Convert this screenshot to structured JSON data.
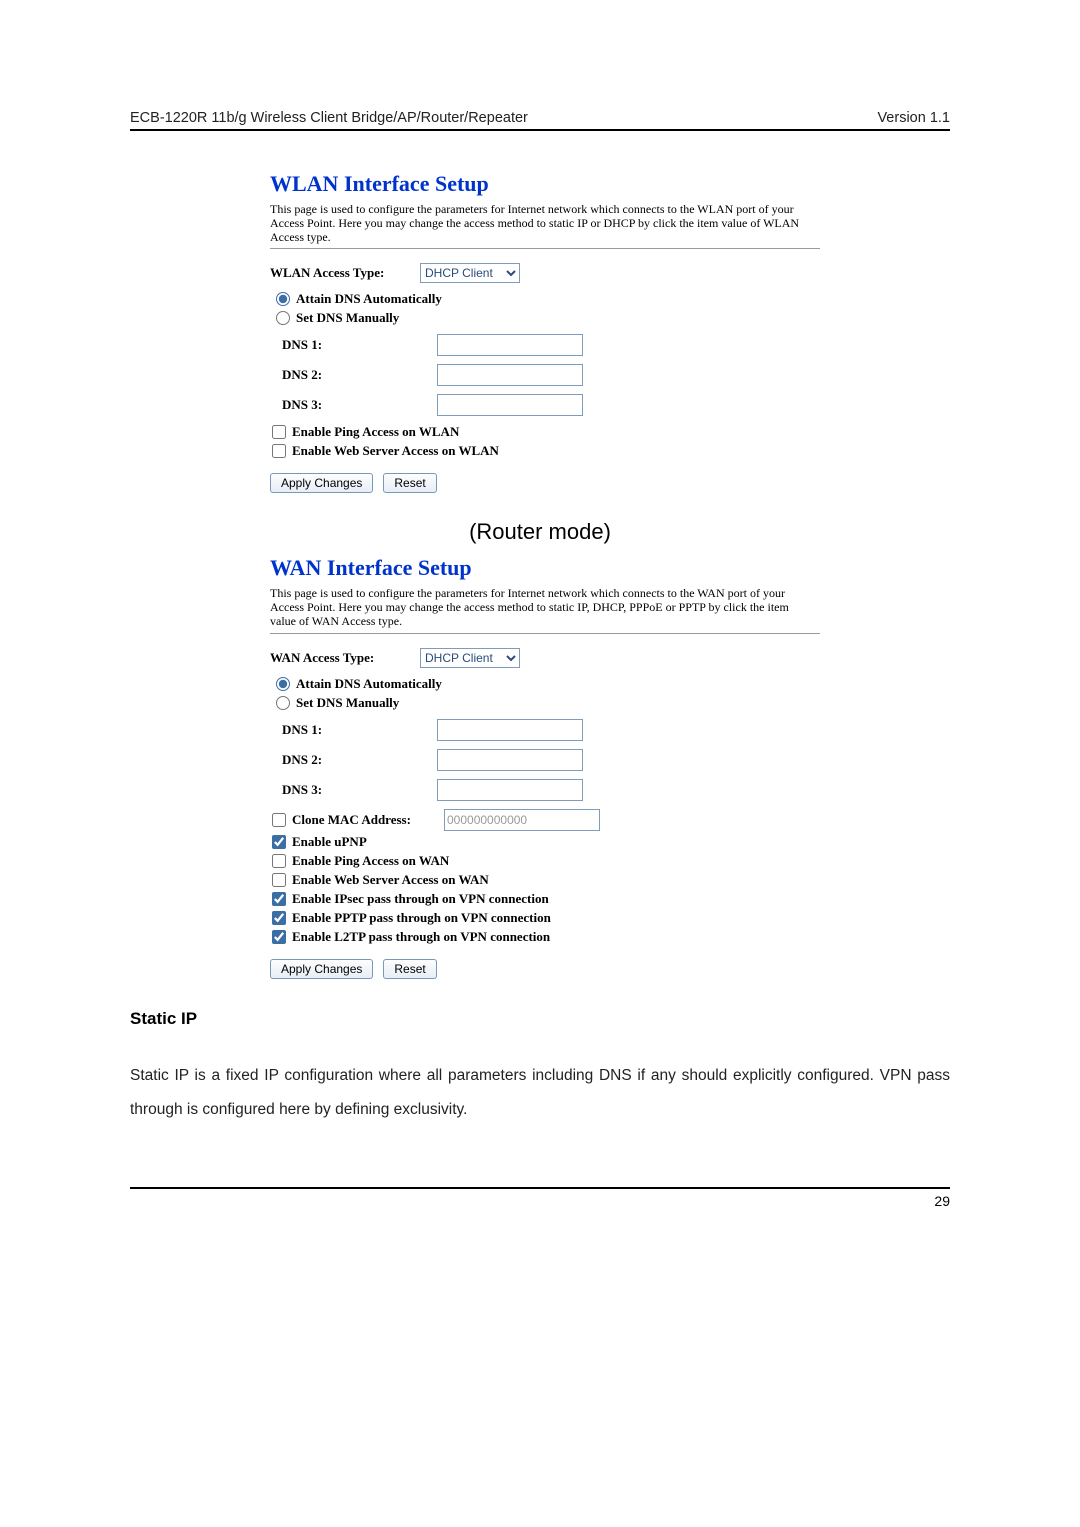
{
  "header": {
    "left": "ECB-1220R 11b/g Wireless Client Bridge/AP/Router/Repeater",
    "right": "Version 1.1"
  },
  "wlan_panel": {
    "title": "WLAN Interface Setup",
    "desc": "This page is used to configure the parameters for Internet network which connects to the WLAN port of your Access Point. Here you may change the access method to static IP or DHCP by click the item value of WLAN Access type.",
    "access_label": "WLAN Access Type:",
    "access_value": "DHCP Client",
    "radio_auto": "Attain DNS Automatically",
    "radio_manual": "Set DNS Manually",
    "dns1_label": "DNS 1:",
    "dns2_label": "DNS 2:",
    "dns3_label": "DNS 3:",
    "cb_ping": "Enable Ping Access on WLAN",
    "cb_web": "Enable Web Server Access on WLAN",
    "apply": "Apply Changes",
    "reset": "Reset"
  },
  "mode_caption": "(Router mode)",
  "wan_panel": {
    "title": "WAN Interface Setup",
    "desc": "This page is used to configure the parameters for Internet network which connects to the WAN port of your Access Point. Here you may change the access method to static IP, DHCP, PPPoE or PPTP by click the item value of WAN Access type.",
    "access_label": "WAN Access Type:",
    "access_value": "DHCP Client",
    "radio_auto": "Attain DNS Automatically",
    "radio_manual": "Set DNS Manually",
    "dns1_label": "DNS 1:",
    "dns2_label": "DNS 2:",
    "dns3_label": "DNS 3:",
    "cb_clone_label": "Clone MAC Address:",
    "cb_clone_value": "000000000000",
    "cb_upnp": "Enable uPNP",
    "cb_ping": "Enable Ping Access on WAN",
    "cb_web": "Enable Web Server Access on WAN",
    "cb_ipsec": "Enable IPsec pass through on VPN connection",
    "cb_pptp": "Enable PPTP pass through on VPN connection",
    "cb_l2tp": "Enable L2TP pass through on VPN connection",
    "apply": "Apply Changes",
    "reset": "Reset"
  },
  "section_heading": "Static IP",
  "body_para": "Static IP is a fixed IP configuration where all parameters including DNS if any should explicitly configured. VPN pass through is configured here by defining exclusivity.",
  "footer_page": "29"
}
